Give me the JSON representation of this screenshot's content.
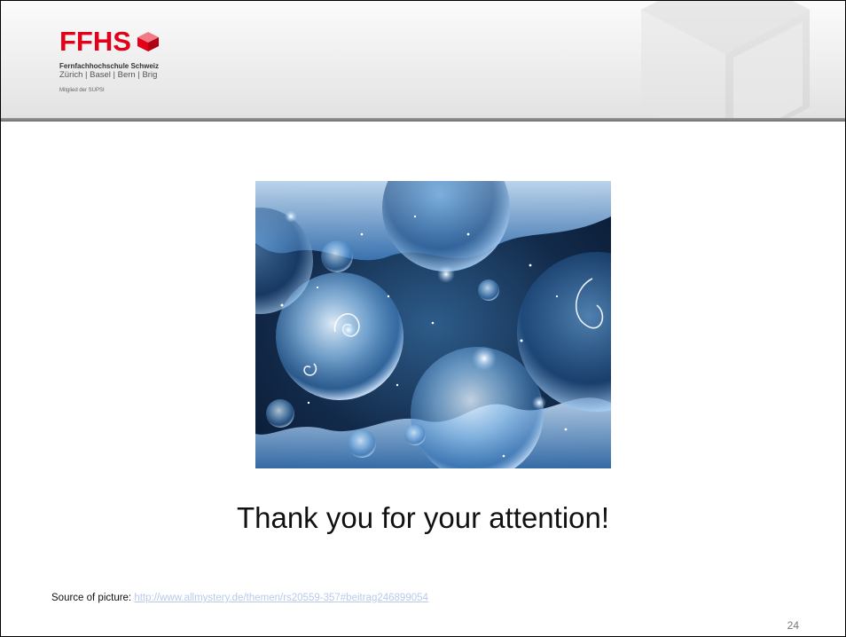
{
  "header": {
    "logo_text": "FFHS",
    "school_name": "Fernfachhochschule Schweiz",
    "cities": "Zürich | Basel | Bern | Brig",
    "member": "Mitglied der SUPSI",
    "logo_icon": "red-cube-icon",
    "brand_color": "#e2001a"
  },
  "main": {
    "picture": "cosmic-bubbles-image",
    "thanks": "Thank you for your attention!"
  },
  "footer": {
    "source_label": "Source of picture: ",
    "source_url": "http://www.allmystery.de/themen/rs20559-357#beitrag246899054",
    "page_number": "24"
  }
}
